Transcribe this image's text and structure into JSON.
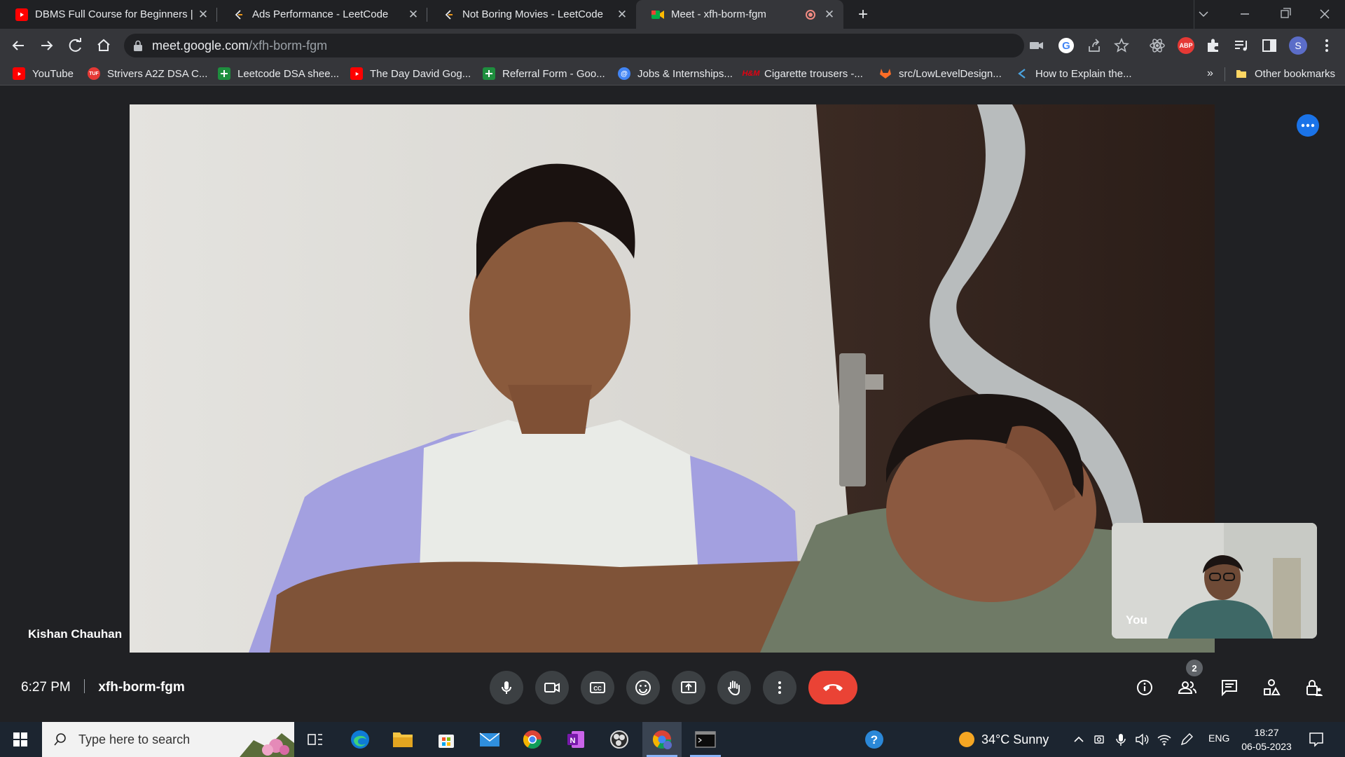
{
  "browser": {
    "tabs": [
      {
        "title": "DBMS Full Course for Beginners |",
        "icon": "youtube-icon",
        "active": false
      },
      {
        "title": "Ads Performance - LeetCode",
        "icon": "leetcode-icon",
        "active": false
      },
      {
        "title": "Not Boring Movies - LeetCode",
        "icon": "leetcode-icon",
        "active": false
      },
      {
        "title": "Meet - xfh-borm-fgm",
        "icon": "google-meet-icon",
        "active": true
      }
    ],
    "url_host": "meet.google.com",
    "url_path": "/xfh-borm-fgm",
    "profile_initial": "S",
    "abp_label": "ABP",
    "bookmarks": [
      {
        "label": "YouTube",
        "icon": "youtube-icon",
        "color": "#ff0000"
      },
      {
        "label": "Strivers A2Z DSA C...",
        "icon": "tuf-icon",
        "color": "#e53935"
      },
      {
        "label": "Leetcode DSA shee...",
        "icon": "sheets-icon",
        "color": "#1e8e3e"
      },
      {
        "label": "The Day David Gog...",
        "icon": "youtube-icon",
        "color": "#ff0000"
      },
      {
        "label": "Referral Form - Goo...",
        "icon": "sheets-icon",
        "color": "#1e8e3e"
      },
      {
        "label": "Jobs & Internships...",
        "icon": "globe-icon",
        "color": "#4285f4"
      },
      {
        "label": "Cigarette trousers -...",
        "icon": "hm-icon",
        "color": "#e50010"
      },
      {
        "label": "src/LowLevelDesign...",
        "icon": "gitlab-icon",
        "color": "#fc6d26"
      },
      {
        "label": "How to Explain the...",
        "icon": "bookmark-c-icon",
        "color": "#4aa3df"
      }
    ],
    "bookmarks_overflow": "»",
    "other_bookmarks": "Other bookmarks"
  },
  "meet": {
    "speaker_name": "Kishan Chauhan",
    "self_label": "You",
    "time": "6:27 PM",
    "meeting_code": "xfh-borm-fgm",
    "people_count": "2",
    "colors": {
      "end_call": "#ea4335",
      "accent": "#1a73e8"
    }
  },
  "taskbar": {
    "search_placeholder": "Type here to search",
    "weather": "34°C  Sunny",
    "language": "ENG",
    "clock_time": "18:27",
    "clock_date": "06-05-2023"
  }
}
